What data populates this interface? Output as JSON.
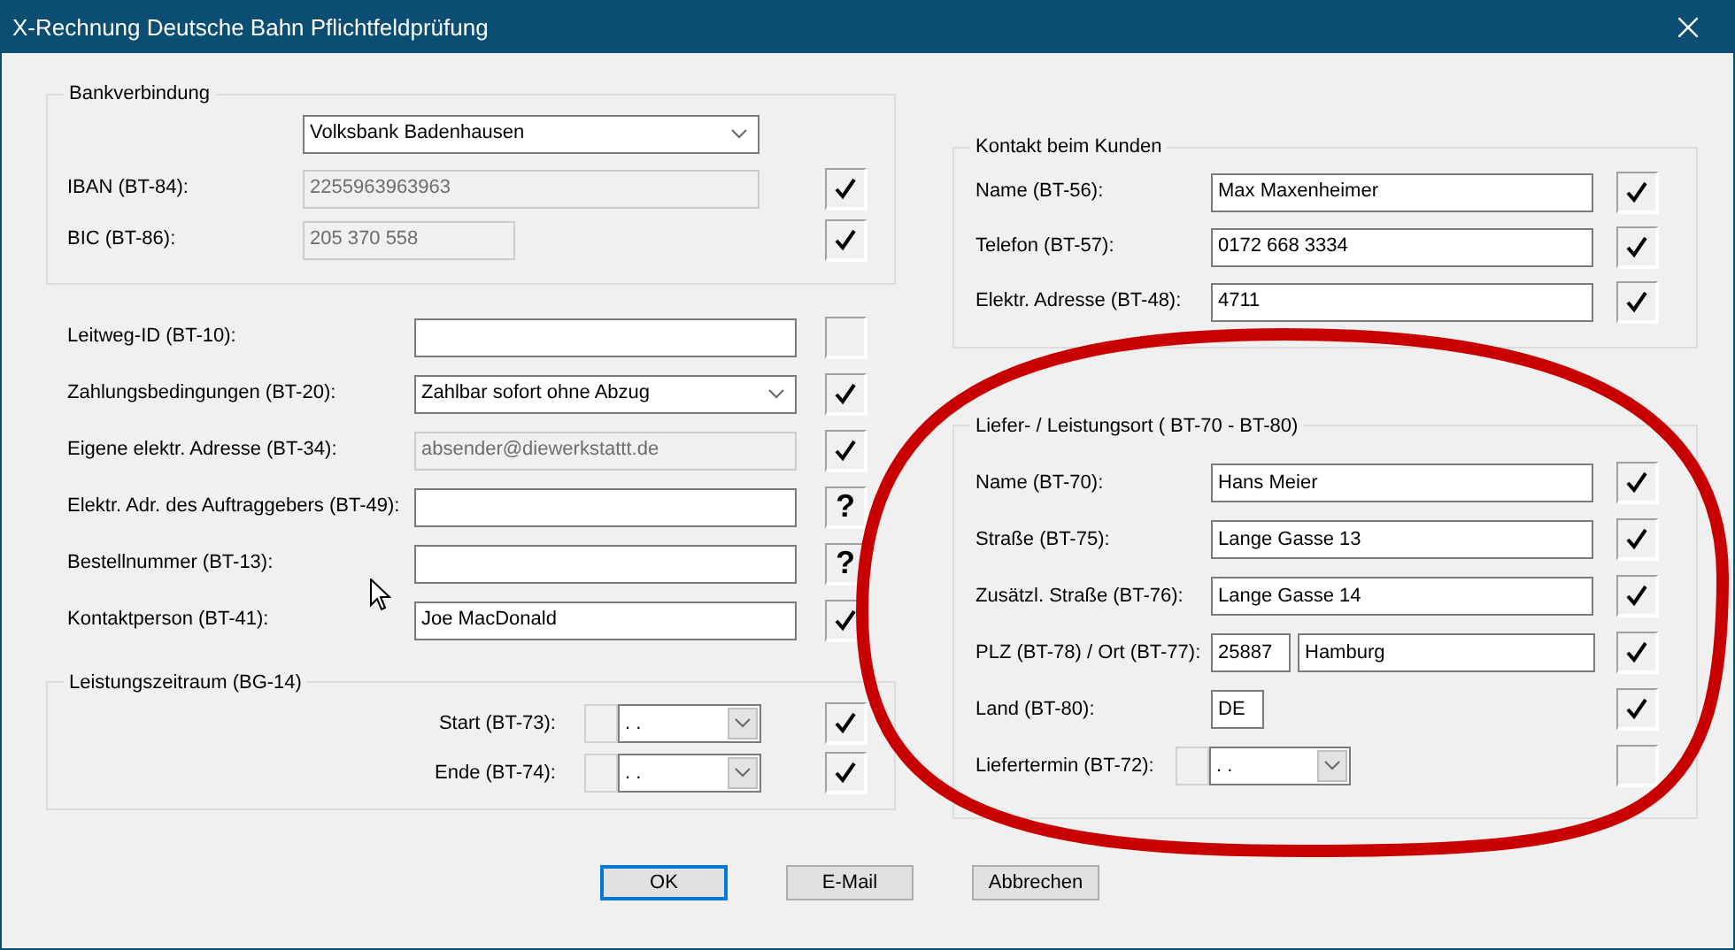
{
  "window": {
    "title": "X-Rechnung Deutsche Bahn Pflichtfeldprüfung"
  },
  "bank": {
    "legend": "Bankverbindung",
    "account": "Volksbank Badenhausen",
    "fields": [
      {
        "label": "IBAN (BT-84):",
        "value": "2255963963963",
        "disabled": true,
        "checked": true
      },
      {
        "label": "BIC (BT-86):",
        "value": "205 370 558",
        "disabled": true,
        "checked": true
      }
    ]
  },
  "fields": [
    {
      "kind": "text",
      "label": "Leitweg-ID (BT-10):",
      "checked": false
    },
    {
      "kind": "combo",
      "label": "Zahlungsbedingungen (BT-20):",
      "value": "Zahlbar sofort ohne Abzug",
      "checked": true
    },
    {
      "kind": "text",
      "label": "Eigene elektr. Adresse (BT-34):",
      "value": "absender@diewerkstattt.de",
      "disabled": true,
      "checked": true
    },
    {
      "kind": "text",
      "label": "Elektr. Adr. des Auftraggebers (BT-49):",
      "symbol": "?"
    },
    {
      "kind": "text",
      "label": "Bestellnummer (BT-13):",
      "symbol": "?"
    },
    {
      "kind": "text",
      "label": "Kontaktperson (BT-41):",
      "value": "Joe MacDonald",
      "checked": true
    }
  ],
  "period": {
    "legend": "Leistungszeitraum (BG-14)",
    "fields": [
      {
        "label": "Start (BT-73):",
        "value": ". .",
        "checked": true
      },
      {
        "label": "Ende (BT-74):",
        "value": ". .",
        "checked": true
      }
    ]
  },
  "contact": {
    "legend": "Kontakt beim Kunden",
    "fields": [
      {
        "kind": "text",
        "label": "Name (BT-56):",
        "values": [
          "Max Maxenheimer"
        ],
        "checked": true
      },
      {
        "kind": "text",
        "label": "Telefon (BT-57):",
        "values": [
          "0172 668 3334"
        ],
        "checked": true
      },
      {
        "kind": "text",
        "label": "Elektr. Adresse (BT-48):",
        "values": [
          "4711"
        ],
        "checked": true
      }
    ]
  },
  "delivery": {
    "legend": "Liefer- / Leistungsort ( BT-70 - BT-80)",
    "fields": [
      {
        "kind": "text",
        "label": "Name (BT-70):",
        "values": [
          "Hans Meier"
        ],
        "checked": true
      },
      {
        "kind": "text",
        "label": "Straße (BT-75):",
        "values": [
          "Lange Gasse 13"
        ],
        "checked": true
      },
      {
        "kind": "text",
        "label": "Zusätzl. Straße (BT-76):",
        "values": [
          "Lange Gasse 14"
        ],
        "checked": true
      },
      {
        "kind": "pair",
        "label": "PLZ (BT-78) / Ort (BT-77):",
        "values": [
          "25887",
          "Hamburg"
        ],
        "checked": true
      },
      {
        "kind": "short",
        "label": "Land (BT-80):",
        "values": [
          "DE"
        ],
        "checked": true
      },
      {
        "kind": "date",
        "label": "Liefertermin (BT-72):",
        "values": [
          ". ."
        ],
        "checked": false
      }
    ]
  },
  "buttons": [
    {
      "label": "OK",
      "default": true
    },
    {
      "label": "E-Mail",
      "default": false
    },
    {
      "label": "Abbrechen",
      "default": false
    }
  ],
  "annotations": [
    {
      "kind": "ellipse"
    }
  ]
}
